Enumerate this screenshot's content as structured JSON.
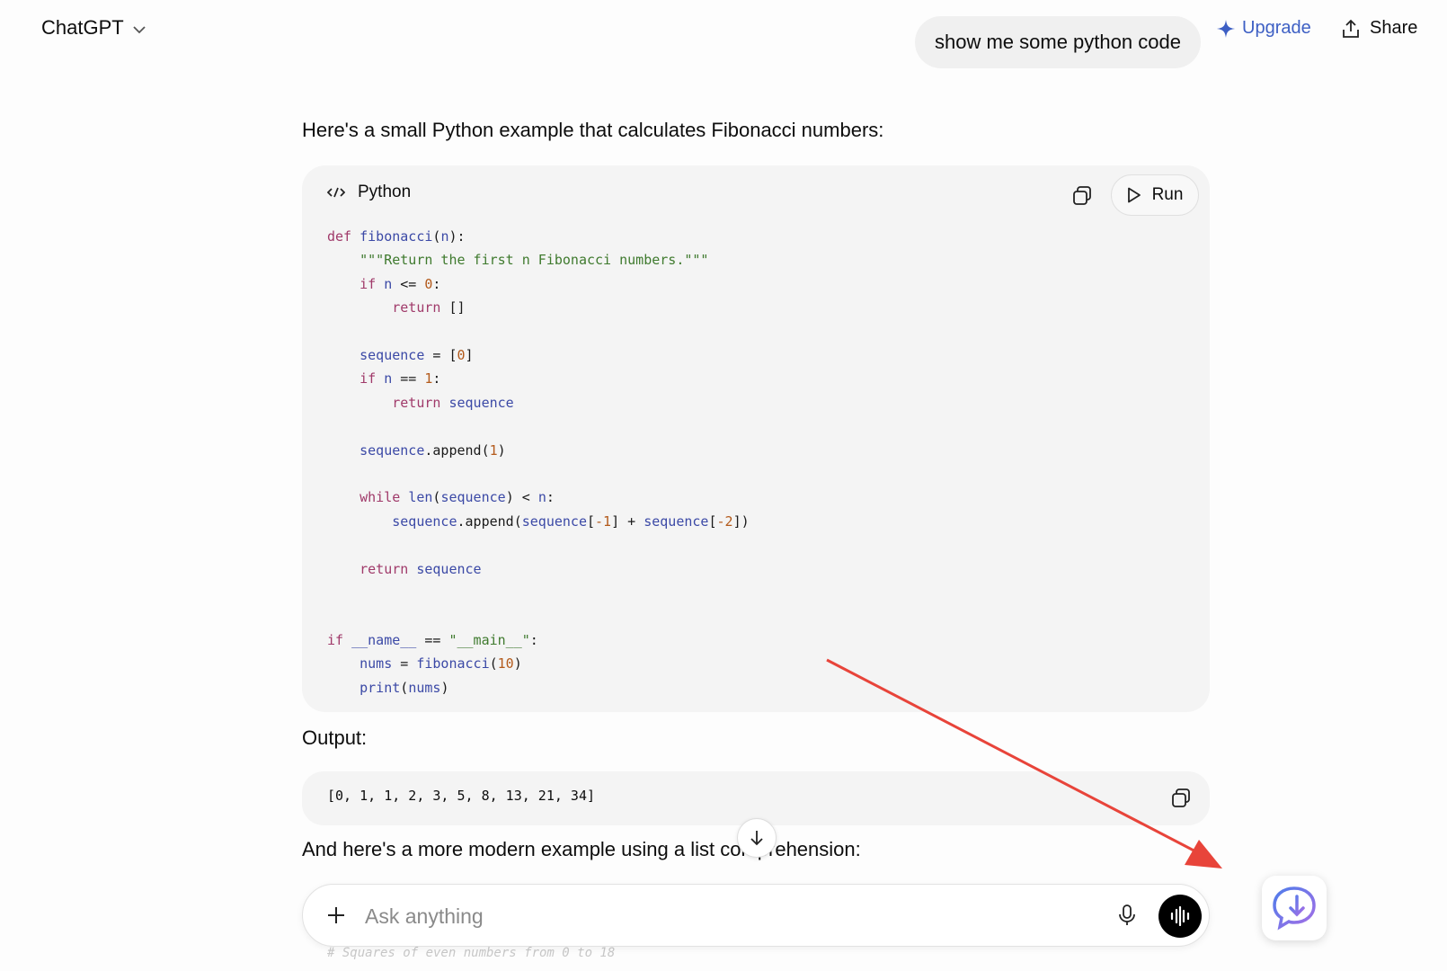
{
  "header": {
    "app_title": "ChatGPT",
    "upgrade_label": "Upgrade",
    "share_label": "Share"
  },
  "user_message": "show me some python code",
  "assistant": {
    "intro": "Here's a small Python example that calculates Fibonacci numbers:",
    "code_block": {
      "language": "Python",
      "run_label": "Run",
      "lines": [
        "def fibonacci(n):",
        "    \"\"\"Return the first n Fibonacci numbers.\"\"\"",
        "    if n <= 0:",
        "        return []",
        "",
        "    sequence = [0]",
        "    if n == 1:",
        "        return sequence",
        "",
        "    sequence.append(1)",
        "",
        "    while len(sequence) < n:",
        "        sequence.append(sequence[-1] + sequence[-2])",
        "",
        "    return sequence",
        "",
        "",
        "if __name__ == \"__main__\":",
        "    nums = fibonacci(10)",
        "    print(nums)"
      ]
    },
    "output_label": "Output:",
    "output_value": "[0, 1, 1, 2, 3, 5, 8, 13, 21, 34]",
    "followup": "And here's a more modern example using a list comprehension:",
    "faded_comment": "# Squares of even numbers from 0 to 18"
  },
  "composer": {
    "placeholder": "Ask anything"
  },
  "colors": {
    "accent": "#3d5fc4",
    "annotation_arrow": "#e8443a",
    "code_bg": "#f4f4f4"
  },
  "icons": [
    "chevron-down-icon",
    "sparkle-icon",
    "share-icon",
    "code-icon",
    "copy-icon",
    "play-icon",
    "arrow-down-icon",
    "plus-icon",
    "mic-icon",
    "voice-waveform-icon",
    "chat-download-icon"
  ]
}
